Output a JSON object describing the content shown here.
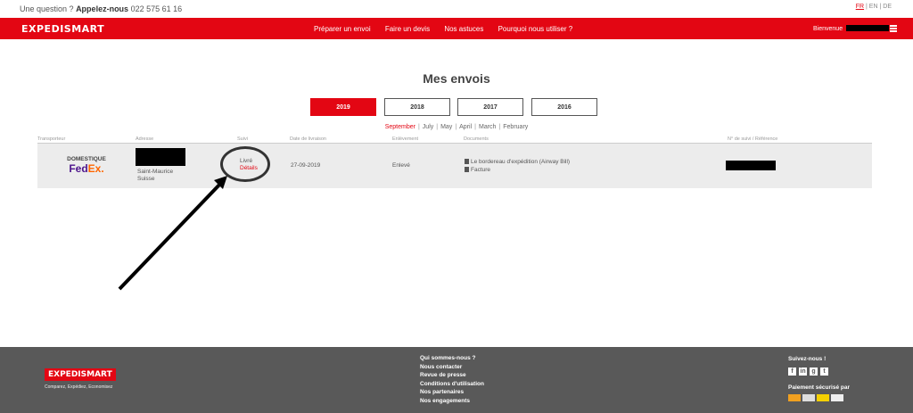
{
  "topbar": {
    "question": "Une question ?",
    "call": "Appelez-nous",
    "phone": "022 575 61 16"
  },
  "languages": {
    "fr": "FR",
    "en": "EN",
    "de": "DE",
    "sep": "|"
  },
  "nav": {
    "logo": "EXPEDISMART",
    "links": [
      "Préparer un envoi",
      "Faire un devis",
      "Nos astuces",
      "Pourquoi nous utiliser ?"
    ],
    "welcome": "Bienvenue"
  },
  "page_title": "Mes envois",
  "years": [
    "2019",
    "2018",
    "2017",
    "2016"
  ],
  "months": [
    "September",
    "July",
    "May",
    "April",
    "March",
    "February"
  ],
  "table": {
    "headers": [
      "Transporteur",
      "Adresse",
      "Suivi",
      "Date de livraison",
      "Enlèvement",
      "Documents",
      "N° de suivi / Référence"
    ],
    "row": {
      "carrier_type": "DOMESTIQUE",
      "carrier_fe": "Fed",
      "carrier_ex": "Ex",
      "carrier_dot": ".",
      "city": "Saint-Maurice",
      "country": "Suisse",
      "status": "Livré",
      "details": "Détails",
      "date": "27-09-2019",
      "pickup": "Enlevé",
      "documents": [
        "Le bordereau d'expédition (Airway Bill)",
        "Facture"
      ]
    }
  },
  "footer": {
    "logo": "EXPEDISMART",
    "tagline": "Comparez, Expédiez, Economisez",
    "links": [
      "Qui sommes-nous ?",
      "Nous contacter",
      "Revue de presse",
      "Conditions d'utilisation",
      "Nos partenaires",
      "Nos engagements"
    ],
    "follow": "Suivez-nous !",
    "social_icons": [
      "facebook-icon",
      "linkedin-icon",
      "googleplus-icon",
      "twitter-icon"
    ],
    "payment": "Paiement sécurisé par"
  },
  "colors": {
    "brand": "#e30613",
    "footer": "#595959"
  }
}
